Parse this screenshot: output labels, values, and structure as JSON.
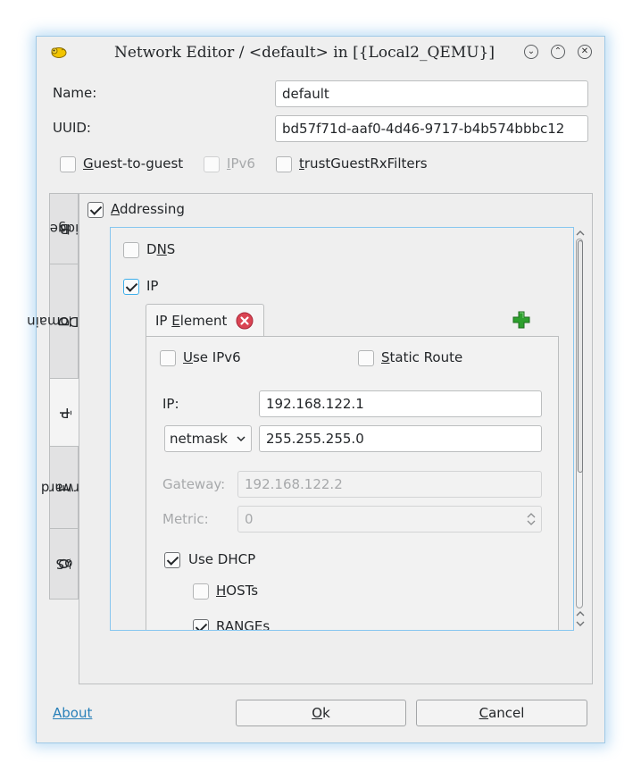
{
  "window": {
    "title": "Network Editor / <default> in [{Local2_QEMU}]",
    "controls": {
      "minimize": "⌄",
      "maximize": "⌃",
      "close": "✕"
    }
  },
  "form": {
    "name_label": "Name:",
    "name_value": "default",
    "uuid_label": "UUID:",
    "uuid_value": "bd57f71d-aaf0-4d46-9717-b4b574bbbc12"
  },
  "options": {
    "guest_to_guest": {
      "pre": "",
      "key": "G",
      "post": "uest-to-guest",
      "checked": false
    },
    "ipv6": {
      "pre": "",
      "key": "I",
      "post": "Pv6",
      "checked": false,
      "enabled": false
    },
    "trust_guest": {
      "pre": "",
      "key": "t",
      "post": "rustGuestRxFilters",
      "checked": false
    }
  },
  "tabs": [
    {
      "pre": "B",
      "key": "r",
      "post": "idge"
    },
    {
      "pre": "",
      "key": "D",
      "post": "NS Domain"
    },
    {
      "pre": "",
      "key": "I",
      "post": "P",
      "active": true
    },
    {
      "pre": "",
      "key": "F",
      "post": "orward"
    },
    {
      "pre": "",
      "key": "Q",
      "post": "oS"
    }
  ],
  "addressing": {
    "pre": "",
    "key": "A",
    "post": "ddressing",
    "checked": true
  },
  "dns": {
    "pre": "D",
    "key": "N",
    "post": "S",
    "checked": false
  },
  "ip": {
    "label": "IP",
    "checked": true
  },
  "ip_element": {
    "tab_pre": "IP ",
    "tab_key": "E",
    "tab_post": "lement",
    "use_ipv6": {
      "pre": "",
      "key": "U",
      "post": "se IPv6",
      "checked": false
    },
    "static_route": {
      "pre": "",
      "key": "S",
      "post": "tatic Route",
      "checked": false
    },
    "ip_label": "IP:",
    "ip_value": "192.168.122.1",
    "mask_mode": "netmask",
    "mask_value": "255.255.255.0",
    "gateway_label": "Gateway:",
    "gateway_placeholder": "192.168.122.2",
    "metric_label": "Metric:",
    "metric_value": "0",
    "use_dhcp": {
      "label": "Use DHCP",
      "checked": true
    },
    "hosts": {
      "pre": "",
      "key": "H",
      "post": "OSTs",
      "checked": false
    },
    "ranges": {
      "pre": "",
      "key": "R",
      "post": "ANGEs",
      "checked": true
    }
  },
  "footer": {
    "about": "About",
    "ok": {
      "pre": "",
      "key": "O",
      "post": "k"
    },
    "cancel": {
      "pre": "",
      "key": "C",
      "post": "ancel"
    }
  },
  "colors": {
    "focus": "#3daee9",
    "link": "#2980b9",
    "add_green": "#2ea02e",
    "remove_red": "#da4453"
  }
}
